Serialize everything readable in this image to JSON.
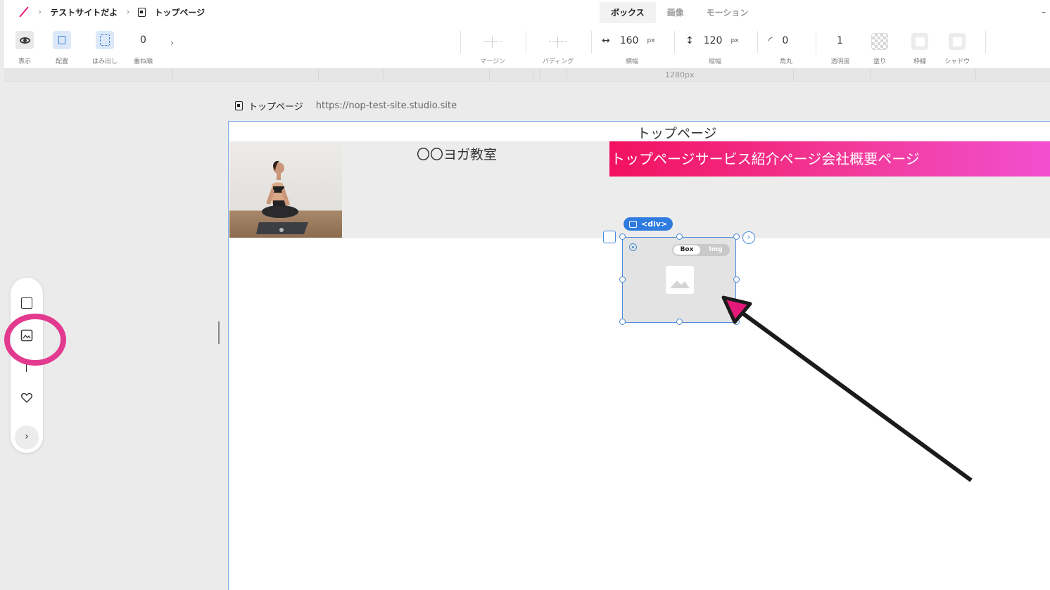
{
  "breadcrumb": {
    "site": "テストサイトだよ",
    "page": "トップページ"
  },
  "tabs": [
    {
      "label": "ボックス",
      "active": true
    },
    {
      "label": "画像",
      "active": false
    },
    {
      "label": "モーション",
      "active": false
    }
  ],
  "toolbar": {
    "display_label": "表示",
    "layout_label": "配置",
    "overflow_label": "はみ出し",
    "zorder_label": "重ね順",
    "zorder_value": "0",
    "margin_label": "マージン",
    "padding_label": "パディング",
    "width_value": "160",
    "width_unit": "px",
    "width_label": "横幅",
    "height_value": "120",
    "height_unit": "px",
    "height_label": "縦幅",
    "radius_value": "0",
    "radius_label": "角丸",
    "opacity_value": "1",
    "opacity_label": "透明度",
    "fill_label": "塗り",
    "border_label": "枠線",
    "shadow_label": "シャドウ"
  },
  "ruler": {
    "label": "1280px"
  },
  "page_header": {
    "name": "トップページ",
    "url": "https://nop-test-site.studio.site"
  },
  "canvas": {
    "page_title": "トップページ",
    "shop_name": "〇〇ヨガ教室",
    "nav_text": "トップページサービス紹介ページ会社概要ページ"
  },
  "selection": {
    "tag": "<div>",
    "toggle_box": "Box",
    "toggle_img": "Img"
  },
  "left_tools": [
    {
      "icon": "square-icon"
    },
    {
      "icon": "image-icon"
    },
    {
      "icon": "line-icon"
    },
    {
      "icon": "heart-icon"
    },
    {
      "icon": "chevron-right-icon"
    }
  ],
  "colors": {
    "accent_pink": "#e6197a",
    "nav_gradient_start": "#f2115f",
    "nav_gradient_end": "#f24fd0",
    "selection_blue": "#2f7ce0"
  }
}
